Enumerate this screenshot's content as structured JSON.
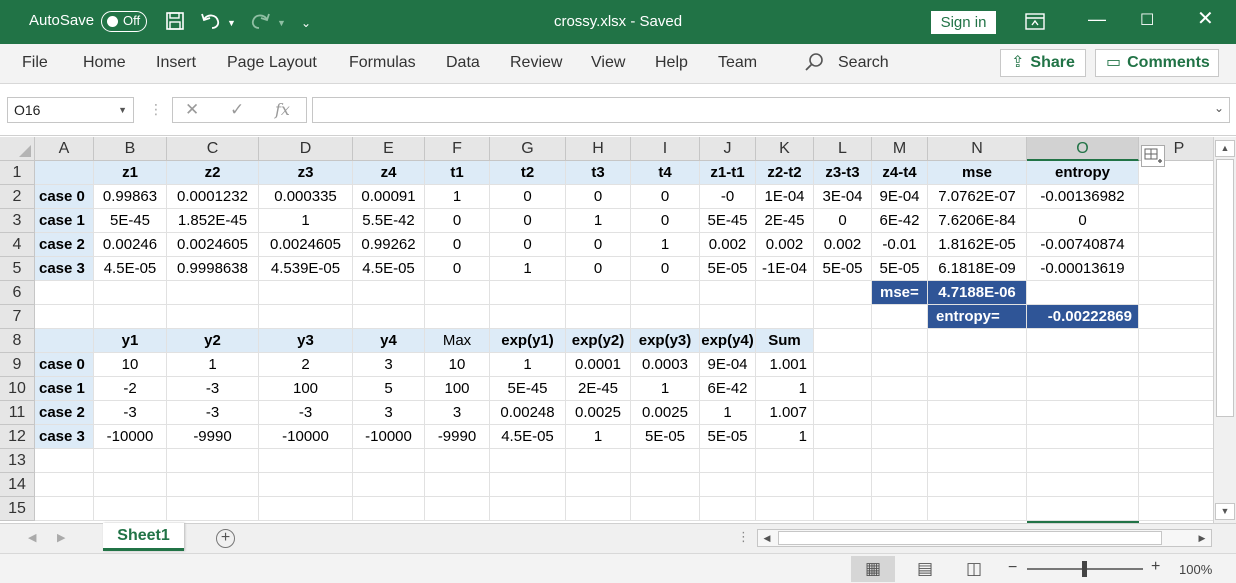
{
  "titlebar": {
    "autosave_label": "AutoSave",
    "autosave_state": "Off",
    "doc_title": "crossy.xlsx  -  Saved",
    "signin": "Sign in"
  },
  "ribbon": {
    "tabs": [
      "File",
      "Home",
      "Insert",
      "Page Layout",
      "Formulas",
      "Data",
      "Review",
      "View",
      "Help",
      "Team"
    ],
    "search": "Search",
    "share": "Share",
    "comments": "Comments"
  },
  "formula_bar": {
    "name_box": "O16",
    "fx": "fx",
    "value": ""
  },
  "grid": {
    "columns": [
      "A",
      "B",
      "C",
      "D",
      "E",
      "F",
      "G",
      "H",
      "I",
      "J",
      "K",
      "L",
      "M",
      "N",
      "O",
      "P"
    ],
    "selected_column": "O",
    "rows": [
      "1",
      "2",
      "3",
      "4",
      "5",
      "6",
      "7",
      "8",
      "9",
      "10",
      "11",
      "12",
      "13",
      "14",
      "15"
    ],
    "table1": {
      "headers": [
        "z1",
        "z2",
        "z3",
        "z4",
        "t1",
        "t2",
        "t3",
        "t4",
        "z1-t1",
        "z2-t2",
        "z3-t3",
        "z4-t4",
        "mse",
        "entropy"
      ],
      "rows": [
        {
          "label": "case 0",
          "values": [
            "0.99863",
            "0.0001232",
            "0.000335",
            "0.00091",
            "1",
            "0",
            "0",
            "0",
            "-0",
            "1E-04",
            "3E-04",
            "9E-04",
            "7.0762E-07",
            "-0.00136982"
          ]
        },
        {
          "label": "case 1",
          "values": [
            "5E-45",
            "1.852E-45",
            "1",
            "5.5E-42",
            "0",
            "0",
            "1",
            "0",
            "5E-45",
            "2E-45",
            "0",
            "6E-42",
            "7.6206E-84",
            "0"
          ]
        },
        {
          "label": "case 2",
          "values": [
            "0.00246",
            "0.0024605",
            "0.0024605",
            "0.99262",
            "0",
            "0",
            "0",
            "1",
            "0.002",
            "0.002",
            "0.002",
            "-0.01",
            "1.8162E-05",
            "-0.00740874"
          ]
        },
        {
          "label": "case 3",
          "values": [
            "4.5E-05",
            "0.9998638",
            "4.539E-05",
            "4.5E-05",
            "0",
            "1",
            "0",
            "0",
            "5E-05",
            "-1E-04",
            "5E-05",
            "5E-05",
            "6.1818E-09",
            "-0.00013619"
          ]
        }
      ]
    },
    "summary": {
      "mse_label": "mse=",
      "mse_value": "4.7188E-06",
      "entropy_label": "entropy=",
      "entropy_value": "-0.00222869"
    },
    "table2": {
      "headers": [
        "y1",
        "y2",
        "y3",
        "y4",
        "Max",
        "exp(y1)",
        "exp(y2)",
        "exp(y3)",
        "exp(y4)",
        "Sum"
      ],
      "rows": [
        {
          "label": "case 0",
          "values": [
            "10",
            "1",
            "2",
            "3",
            "10",
            "1",
            "0.0001",
            "0.0003",
            "9E-04",
            "1.001"
          ]
        },
        {
          "label": "case 1",
          "values": [
            "-2",
            "-3",
            "100",
            "5",
            "100",
            "5E-45",
            "2E-45",
            "1",
            "6E-42",
            "1"
          ]
        },
        {
          "label": "case 2",
          "values": [
            "-3",
            "-3",
            "-3",
            "3",
            "3",
            "0.00248",
            "0.0025",
            "0.0025",
            "1",
            "1.007"
          ]
        },
        {
          "label": "case 3",
          "values": [
            "-10000",
            "-9990",
            "-10000",
            "-10000",
            "-9990",
            "4.5E-05",
            "1",
            "5E-05",
            "5E-05",
            "1"
          ]
        }
      ]
    }
  },
  "sheet_tabs": {
    "active": "Sheet1"
  },
  "status": {
    "zoom": "100%"
  },
  "colors": {
    "excel_green": "#217346",
    "header_fill": "#ddebf7",
    "summary_fill": "#2f5597"
  }
}
